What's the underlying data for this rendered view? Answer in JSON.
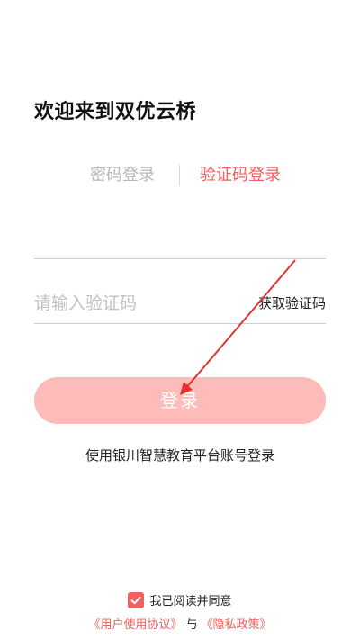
{
  "header": {
    "welcome": "欢迎来到双优云桥"
  },
  "tabs": {
    "password": "密码登录",
    "code": "验证码登录",
    "active": "code"
  },
  "form": {
    "phone_value": "",
    "code_placeholder": "请输入验证码",
    "get_code_label": "获取验证码",
    "login_label": "登录"
  },
  "alt_login": "使用银川智慧教育平台账号登录",
  "agreement": {
    "checked": true,
    "text": "我已阅读并同意",
    "user_agreement": "《用户使用协议》",
    "and": "与",
    "privacy_policy": "《隐私政策》"
  },
  "colors": {
    "accent": "#f0605f",
    "button_bg": "#fdbcb9",
    "inactive_tab": "#b8b8b8"
  }
}
